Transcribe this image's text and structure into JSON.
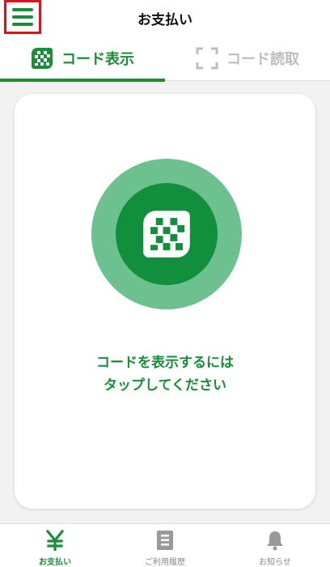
{
  "header": {
    "title": "お支払い",
    "menu_icon": "hamburger-menu-icon"
  },
  "tabs": [
    {
      "label": "コード表示",
      "icon": "qr-code-icon",
      "active": true
    },
    {
      "label": "コード読取",
      "icon": "scan-frame-icon",
      "active": false
    }
  ],
  "card": {
    "button_icon": "qr-code-icon",
    "prompt_line1": "コードを表示するには",
    "prompt_line2": "タップしてください"
  },
  "bottom_nav": [
    {
      "label": "お支払い",
      "icon": "yen-icon",
      "active": true
    },
    {
      "label": "ご利用履歴",
      "icon": "history-document-icon",
      "active": false
    },
    {
      "label": "お知らせ",
      "icon": "bell-icon",
      "active": false
    }
  ],
  "colors": {
    "accent": "#1a8c3a",
    "accent_light": "#6cc18e",
    "accent_dark": "#128f3d",
    "inactive": "#bdbdbd",
    "highlight_border": "#e0101a"
  }
}
